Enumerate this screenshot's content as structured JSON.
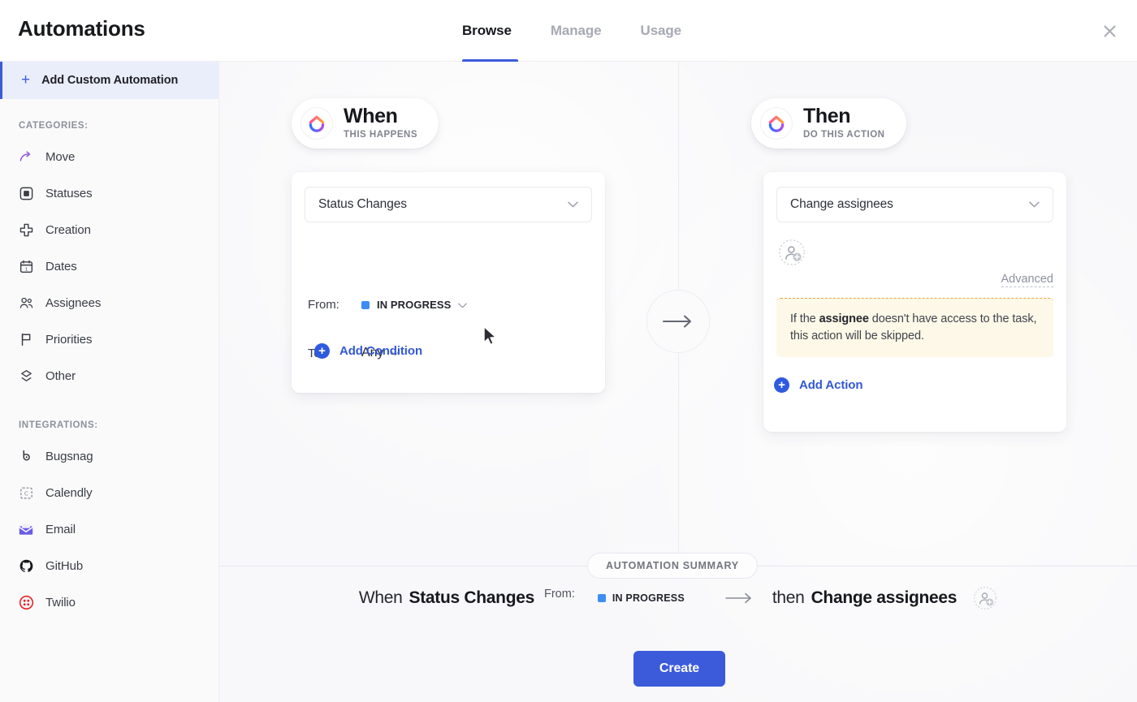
{
  "header": {
    "title": "Automations",
    "tabs": [
      {
        "label": "Browse",
        "active": true
      },
      {
        "label": "Manage",
        "active": false
      },
      {
        "label": "Usage",
        "active": false
      }
    ],
    "close_icon": "close-icon"
  },
  "sidebar": {
    "add_custom": {
      "label": "Add Custom Automation",
      "icon": "plus-icon",
      "plus": "+"
    },
    "categories_title": "CATEGORIES:",
    "categories": [
      {
        "label": "Move",
        "icon": "move-arrow-icon"
      },
      {
        "label": "Statuses",
        "icon": "status-square-icon"
      },
      {
        "label": "Creation",
        "icon": "plus-cross-icon"
      },
      {
        "label": "Dates",
        "icon": "calendar-icon"
      },
      {
        "label": "Assignees",
        "icon": "people-icon"
      },
      {
        "label": "Priorities",
        "icon": "flag-icon"
      },
      {
        "label": "Other",
        "icon": "layers-icon"
      }
    ],
    "integrations_title": "INTEGRATIONS:",
    "integrations": [
      {
        "label": "Bugsnag",
        "icon": "bugsnag-icon"
      },
      {
        "label": "Calendly",
        "icon": "calendly-icon"
      },
      {
        "label": "Email",
        "icon": "email-icon"
      },
      {
        "label": "GitHub",
        "icon": "github-icon"
      },
      {
        "label": "Twilio",
        "icon": "twilio-icon"
      }
    ]
  },
  "builder": {
    "when": {
      "badge_title": "When",
      "badge_subtitle": "THIS HAPPENS",
      "logo_icon": "clickup-logo-icon",
      "trigger_value": "Status Changes",
      "chevron": "⌄",
      "conditions": [
        {
          "key": "From:",
          "value": "IN PROGRESS",
          "has_status_swatch": true,
          "status_color": "#3d8df5",
          "chevron": "⌄"
        },
        {
          "key": "To:",
          "value": "Any",
          "has_status_swatch": false,
          "chevron": "⌄"
        }
      ],
      "add_condition_label": "Add Condition",
      "add_condition_icon": "circle-plus-icon"
    },
    "arrow_icon": "arrow-right-icon",
    "then": {
      "badge_title": "Then",
      "badge_subtitle": "DO THIS ACTION",
      "logo_icon": "clickup-logo-icon",
      "action_value": "Change assignees",
      "chevron": "⌄",
      "assignee_icon": "add-assignee-icon",
      "advanced_label": "Advanced",
      "warning": {
        "prefix": "If the ",
        "bold": "assignee",
        "suffix": " doesn't have access to the task, this action will be skipped."
      },
      "add_action_label": "Add Action",
      "add_action_icon": "circle-plus-icon"
    }
  },
  "summary": {
    "chip_label": "AUTOMATION SUMMARY",
    "when_word": "When",
    "trigger": "Status Changes",
    "from_label": "From:",
    "status": "IN PROGRESS",
    "status_color": "#3d8df5",
    "arrow_icon": "arrow-right-icon",
    "then_word": "then",
    "action": "Change assignees",
    "assignee_icon": "add-assignee-icon",
    "create_label": "Create"
  },
  "colors": {
    "accent_blue": "#3b5bdb",
    "link_blue": "#3358d4",
    "status_blue": "#3d8df5",
    "warning_bg": "#fdf8e7",
    "warning_border": "#e8a33d",
    "canvas_bg": "#f8f8fa",
    "sidebar_bg": "#fafafb"
  }
}
